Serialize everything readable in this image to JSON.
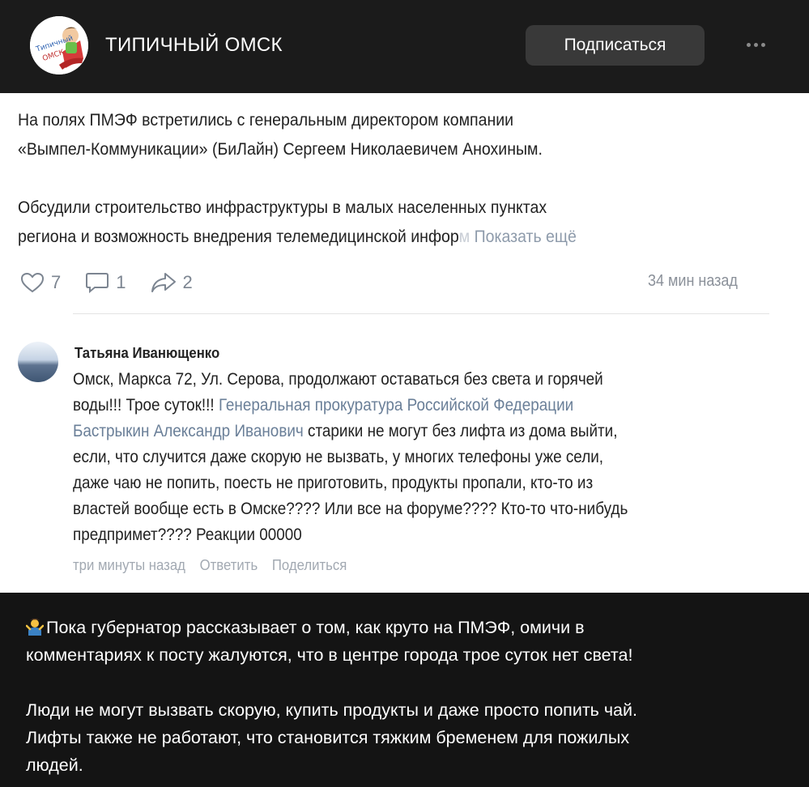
{
  "header": {
    "channel_name": "ТИПИЧНЫЙ ОМСК",
    "subscribe_label": "Подписаться",
    "avatar_logo_text": "Типичный ОМСК"
  },
  "post": {
    "lines": [
      "На полях ПМЭФ встретились с генеральным директором компании",
      "«Вымпел-Коммуникации» (БиЛайн) Сергеем Николаевичем Анохиным."
    ],
    "lines2_a": "Обсудили строительство инфраструктуры в малых населенных пунктах",
    "lines2_b": "региона и возможность внедрения телемедицинской инфор",
    "lines2_fade": "м",
    "show_more": "Показать ещё",
    "likes": "7",
    "comments": "1",
    "shares": "2",
    "time": "34 мин назад"
  },
  "comment": {
    "author": "Татьяна Иванющенко",
    "l1": "Омск, Маркса 72, Ул. Серова, продолжают оставаться без света и горячей",
    "l2_text": "воды!!! Трое суток!!! ",
    "l2_mention": "Генеральная прокуратура Российской Федерации",
    "l3_mention": "Бастрыкин Александр Иванович",
    "l3_text": " старики не могут без лифта из дома выйти,",
    "l4": "если, что случится даже скорую не вызвать, у многих телефоны уже сели,",
    "l5": "даже чаю не попить, поесть не приготовить, продукты пропали, кто-то из",
    "l6": "властей вообще есть в Омске???? Или все на форуме???? Кто-то что-нибудь",
    "l7": "предпримет???? Реакции 00000",
    "time": "три минуты назад",
    "reply": "Ответить",
    "share": "Поделиться"
  },
  "caption": {
    "l1": "Пока губернатор рассказывает о том, как круто на ПМЭФ, омичи в",
    "l2": "комментариях к посту жалуются, что в центре города трое суток нет света!",
    "l3": "Люди не могут вызвать скорую, купить продукты и даже просто попить чай.",
    "l4": "Лифты также не работают, что становится тяжким бременем для пожилых",
    "l5": "людей."
  },
  "icons": [
    "heart-icon",
    "comment-icon",
    "share-icon",
    "more-icon",
    "shrug-emoji-icon"
  ],
  "colors": {
    "background": "#141414",
    "header": "#1b1b1b",
    "button": "#393939",
    "mention": "#6a7f98"
  }
}
